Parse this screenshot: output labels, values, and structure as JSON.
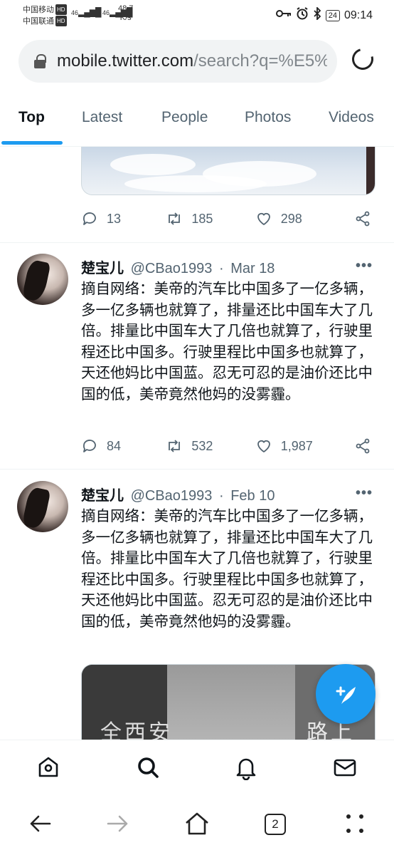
{
  "status_bar": {
    "carrier1": "中国移动",
    "carrier2": "中国联通",
    "hd_badge": "HD",
    "signal1": "46",
    "signal2": "46",
    "net_speed_value": "48.7",
    "net_speed_unit": "K/s",
    "battery": "24",
    "time": "09:14",
    "icons": [
      "key-icon",
      "alarm-icon",
      "bluetooth-icon",
      "battery-icon"
    ]
  },
  "browser": {
    "url_host": "mobile.twitter.com",
    "url_path": "/search?q=%E5%",
    "icons": [
      "lock-icon",
      "reload-icon"
    ]
  },
  "tabs": [
    {
      "label": "Top",
      "active": true
    },
    {
      "label": "Latest",
      "active": false
    },
    {
      "label": "People",
      "active": false
    },
    {
      "label": "Photos",
      "active": false
    },
    {
      "label": "Videos",
      "active": false
    }
  ],
  "first_actions": {
    "replies": "13",
    "retweets": "185",
    "likes": "298"
  },
  "tweets": [
    {
      "name": "楚宝儿",
      "handle": "@CBao1993",
      "separator": "·",
      "date": "Mar 18",
      "more": "•••",
      "text": "摘自网络：美帝的汽车比中国多了一亿多辆， 多一亿多辆也就算了，排量还比中国车大了几倍。排量比中国车大了几倍也就算了，行驶里程还比中国多。行驶里程比中国多也就算了，天还他妈比中国蓝。忍无可忍的是油价还比中国的低，美帝竟然他妈的没雾霾。",
      "replies": "84",
      "retweets": "532",
      "likes": "1,987"
    },
    {
      "name": "楚宝儿",
      "handle": "@CBao1993",
      "separator": "·",
      "date": "Feb 10",
      "more": "•••",
      "text": "摘自网络：美帝的汽车比中国多了一亿多辆， 多一亿多辆也就算了，排量还比中国车大了几倍。排量比中国车大了几倍也就算了，行驶里程还比中国多。行驶里程比中国多也就算了，天还他妈比中国蓝。忍无可忍的是油价还比中国的低，美帝竟然他妈的没雾霾。",
      "media_caption_left": "全西安",
      "media_caption_right": "路上"
    }
  ],
  "bottom_nav": [
    "home-icon",
    "search-icon",
    "notifications-icon",
    "messages-icon"
  ],
  "system_nav": {
    "tab_count": "2"
  },
  "colors": {
    "accent": "#1d9bf0",
    "text": "#0f1419",
    "secondary": "#536471"
  }
}
